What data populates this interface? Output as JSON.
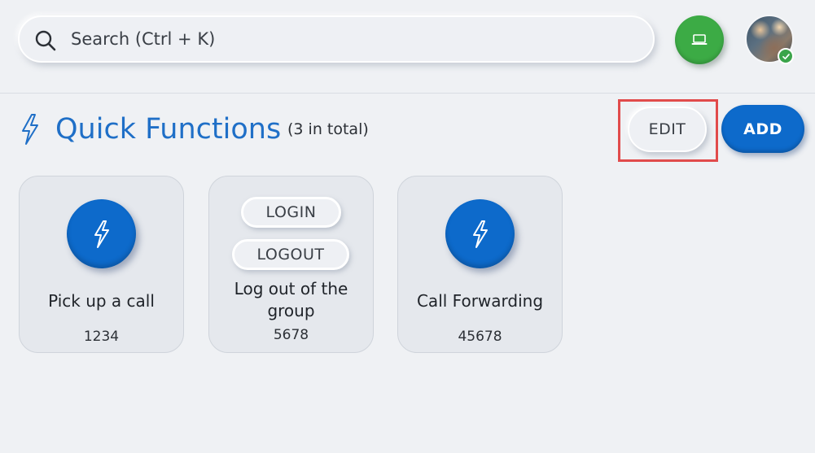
{
  "search": {
    "placeholder": "Search (Ctrl + K)",
    "icon": "search-icon"
  },
  "header": {
    "device_button_icon": "laptop-icon",
    "device_button_color": "#3cab45",
    "avatar_status": "online",
    "status_color": "#3ba44a"
  },
  "page": {
    "title": "Quick Functions",
    "count": "(3 in total)",
    "title_icon": "lightning-bolt-icon",
    "accent_color": "#1f6fc7"
  },
  "actions": {
    "edit_label": "EDIT",
    "add_label": "ADD",
    "add_color": "#0d6acb",
    "highlight_color": "#e14b4b"
  },
  "cards": [
    {
      "icon": "lightning-bolt-icon",
      "label": "Pick up a call",
      "number": "1234"
    },
    {
      "buttons": [
        "LOGIN",
        "LOGOUT"
      ],
      "label": "Log out of the group",
      "number": "5678"
    },
    {
      "icon": "lightning-bolt-icon",
      "label": "Call Forwarding",
      "number": "45678"
    }
  ]
}
